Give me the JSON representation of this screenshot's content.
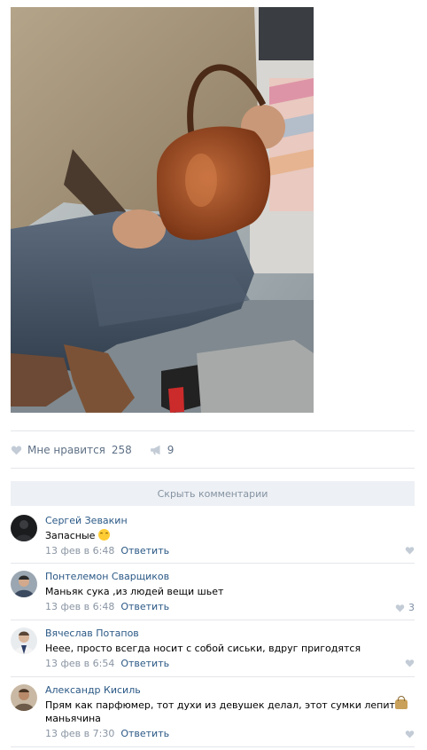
{
  "post": {
    "photo_alt": "",
    "likes": {
      "label": "Мне нравится",
      "count": "258"
    },
    "shares": {
      "count": "9"
    },
    "hide_comments_label": "Скрыть комментарии"
  },
  "comments": [
    {
      "author": "Сергей Зевакин",
      "text": "Запасные",
      "emoji": "laughing-tears",
      "date": "13 фев в 6:48",
      "reply": "Ответить",
      "likes": ""
    },
    {
      "author": "Понтелемон Сварщиков",
      "text": "Маньяк сука ,из людей вещи шьет",
      "date": "13 фев в 6:48",
      "reply": "Ответить",
      "likes": "3"
    },
    {
      "author": "Вячеслав Потапов",
      "text": "Неее, просто всегда носит с собой сиськи, вдруг пригодятся",
      "date": "13 фев в 6:54",
      "reply": "Ответить",
      "likes": ""
    },
    {
      "author": "Александр Кисиль",
      "text_line1": "Прям как парфюмер, тот духи из девушек делал, этот сумки лепит",
      "text_line2": "маньячина",
      "emoji": "handbag",
      "date": "13 фев в 7:30",
      "reply": "Ответить",
      "likes": ""
    }
  ],
  "colors": {
    "link": "#2a5885",
    "muted": "#8a95a3",
    "hide_bar_bg": "#edf0f4",
    "divider": "#e4e6ea"
  }
}
